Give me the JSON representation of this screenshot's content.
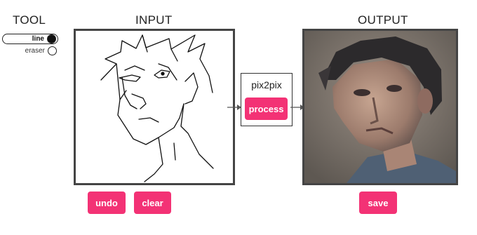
{
  "tool": {
    "title": "TOOL",
    "options": [
      {
        "label": "line",
        "selected": true
      },
      {
        "label": "eraser",
        "selected": false
      }
    ]
  },
  "input": {
    "title": "INPUT"
  },
  "output": {
    "title": "OUTPUT"
  },
  "model": {
    "name": "pix2pix",
    "process_label": "process"
  },
  "actions": {
    "undo_label": "undo",
    "clear_label": "clear",
    "save_label": "save"
  },
  "colors": {
    "accent": "#f33275",
    "frame": "#444444"
  }
}
